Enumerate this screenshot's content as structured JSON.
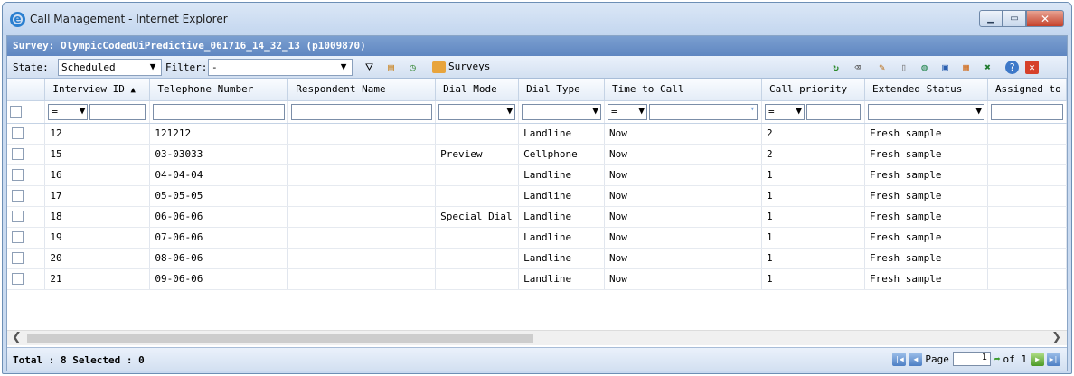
{
  "window": {
    "title": "Call Management - Internet Explorer"
  },
  "survey": {
    "label": "Survey: OlympicCodedUiPredictive_061716_14_32_13 (p1009870)"
  },
  "toolbar": {
    "state_label": "State:",
    "state_value": "Scheduled",
    "filter_label": "Filter:",
    "filter_value": "-",
    "surveys_label": "Surveys"
  },
  "grid": {
    "columns": [
      "Interview ID",
      "Telephone Number",
      "Respondent Name",
      "Dial Mode",
      "Dial Type",
      "Time to Call",
      "Call priority",
      "Extended Status",
      "Assigned to"
    ],
    "filters": {
      "interview_op": "=",
      "time_op": "=",
      "priority_op": "="
    },
    "rows": [
      {
        "id": "12",
        "phone": "121212",
        "name": "",
        "dial_mode": "",
        "dial_type": "Landline",
        "time": "Now",
        "priority": "2",
        "status": "Fresh sample",
        "assigned": ""
      },
      {
        "id": "15",
        "phone": "03-03033",
        "name": "",
        "dial_mode": "Preview",
        "dial_type": "Cellphone",
        "time": "Now",
        "priority": "2",
        "status": "Fresh sample",
        "assigned": ""
      },
      {
        "id": "16",
        "phone": "04-04-04",
        "name": "",
        "dial_mode": "",
        "dial_type": "Landline",
        "time": "Now",
        "priority": "1",
        "status": "Fresh sample",
        "assigned": ""
      },
      {
        "id": "17",
        "phone": "05-05-05",
        "name": "",
        "dial_mode": "",
        "dial_type": "Landline",
        "time": "Now",
        "priority": "1",
        "status": "Fresh sample",
        "assigned": ""
      },
      {
        "id": "18",
        "phone": "06-06-06",
        "name": "",
        "dial_mode": "Special Dial",
        "dial_type": "Landline",
        "time": "Now",
        "priority": "1",
        "status": "Fresh sample",
        "assigned": ""
      },
      {
        "id": "19",
        "phone": "07-06-06",
        "name": "",
        "dial_mode": "",
        "dial_type": "Landline",
        "time": "Now",
        "priority": "1",
        "status": "Fresh sample",
        "assigned": ""
      },
      {
        "id": "20",
        "phone": "08-06-06",
        "name": "",
        "dial_mode": "",
        "dial_type": "Landline",
        "time": "Now",
        "priority": "1",
        "status": "Fresh sample",
        "assigned": ""
      },
      {
        "id": "21",
        "phone": "09-06-06",
        "name": "",
        "dial_mode": "",
        "dial_type": "Landline",
        "time": "Now",
        "priority": "1",
        "status": "Fresh sample",
        "assigned": ""
      }
    ]
  },
  "status": {
    "total_text": "Total : 8 Selected : 0",
    "page_label": "Page",
    "page_value": "1",
    "of_label": "of 1"
  },
  "icons": [
    "ie-icon",
    "minimize-icon",
    "restore-icon",
    "close-icon",
    "filter-icon",
    "schedule-icon",
    "clock-icon",
    "surveys-folder-icon",
    "refresh-icon",
    "eraser-icon",
    "edit-icon",
    "new-document-icon",
    "web-icon",
    "monitor-icon",
    "export-icon",
    "excel-icon",
    "help-icon",
    "close-red-icon"
  ]
}
